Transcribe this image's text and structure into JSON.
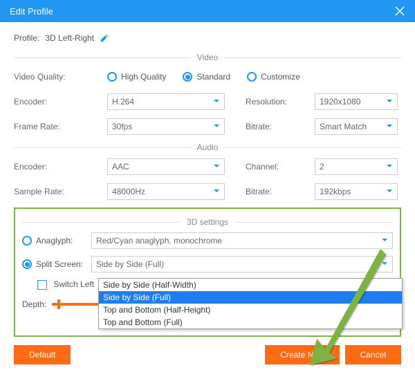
{
  "titlebar": {
    "title": "Edit Profile"
  },
  "profile": {
    "label": "Profile:",
    "name": "3D Left-Right"
  },
  "sections": {
    "video": "Video",
    "audio": "Audio",
    "threeD": "3D settings"
  },
  "video": {
    "quality_label": "Video Quality:",
    "quality_opts": {
      "high": "High Quality",
      "standard": "Standard",
      "customize": "Customize"
    },
    "encoder_label": "Encoder:",
    "encoder_value": "H.264",
    "resolution_label": "Resolution:",
    "resolution_value": "1920x1080",
    "framerate_label": "Frame Rate:",
    "framerate_value": "30fps",
    "bitrate_label": "Bitrate:",
    "bitrate_value": "Smart Match"
  },
  "audio": {
    "encoder_label": "Encoder:",
    "encoder_value": "AAC",
    "channel_label": "Channel:",
    "channel_value": "2",
    "samplerate_label": "Sample Rate:",
    "samplerate_value": "48000Hz",
    "bitrate_label": "Bitrate:",
    "bitrate_value": "192kbps"
  },
  "threeD": {
    "anaglyph_label": "Anaglyph:",
    "anaglyph_value": "Red/Cyan anaglyph, monochrome",
    "split_label": "Split Screen:",
    "split_value": "Side by Side (Full)",
    "switch_label": "Switch Left",
    "depth_label": "Depth:",
    "options": {
      "o0": "Side by Side (Half-Width)",
      "o1": "Side by Side (Full)",
      "o2": "Top and Bottom (Half-Height)",
      "o3": "Top and Bottom (Full)"
    }
  },
  "buttons": {
    "default": "Default",
    "create": "Create New",
    "cancel": "Cancel"
  }
}
